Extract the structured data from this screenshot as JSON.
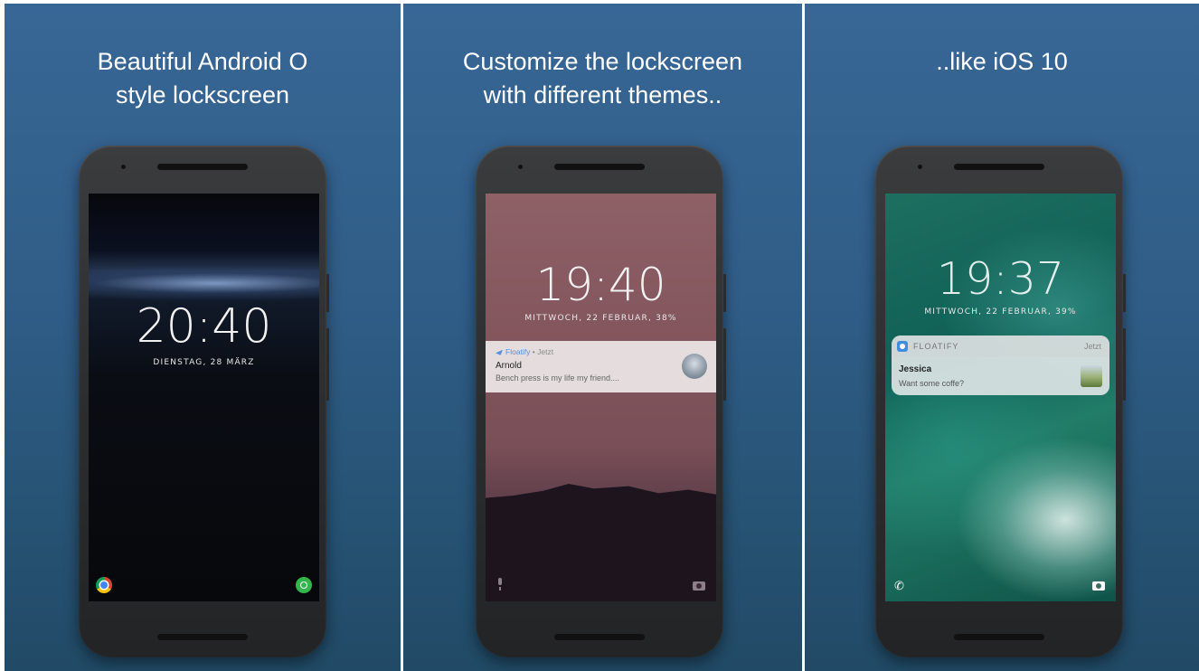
{
  "panels": [
    {
      "title": "Beautiful Android O\nstyle lockscreen",
      "lockscreen": {
        "time": "20:40",
        "date": "DIENSTAG, 28 MÄRZ"
      },
      "dock_icons": [
        "chrome-icon",
        "whatsapp-icon"
      ]
    },
    {
      "title": "Customize the lockscreen\nwith different themes..",
      "lockscreen": {
        "time": "19:40",
        "date": "MITTWOCH, 22 FEBRUAR, 38%"
      },
      "notification": {
        "app": "Floatify",
        "separator": " • ",
        "when": "Jetzt",
        "title": "Arnold",
        "text": "Bench press is my life my friend...."
      },
      "dock_icons": [
        "mic-icon",
        "camera-icon"
      ]
    },
    {
      "title": "..like iOS 10",
      "lockscreen": {
        "time": "19:37",
        "date": "MITTWOCH, 22 FEBRUAR, 39%"
      },
      "notification": {
        "app": "FLOATIFY",
        "when": "Jetzt",
        "title": "Jessica",
        "text": "Want some coffe?"
      },
      "dock_icons": [
        "phone-icon",
        "camera-icon"
      ]
    }
  ],
  "colors": {
    "panel_background": "#2f5d87",
    "android_notification_bg": "#e4dcdd",
    "floatify_accent": "#5b8fd6"
  }
}
